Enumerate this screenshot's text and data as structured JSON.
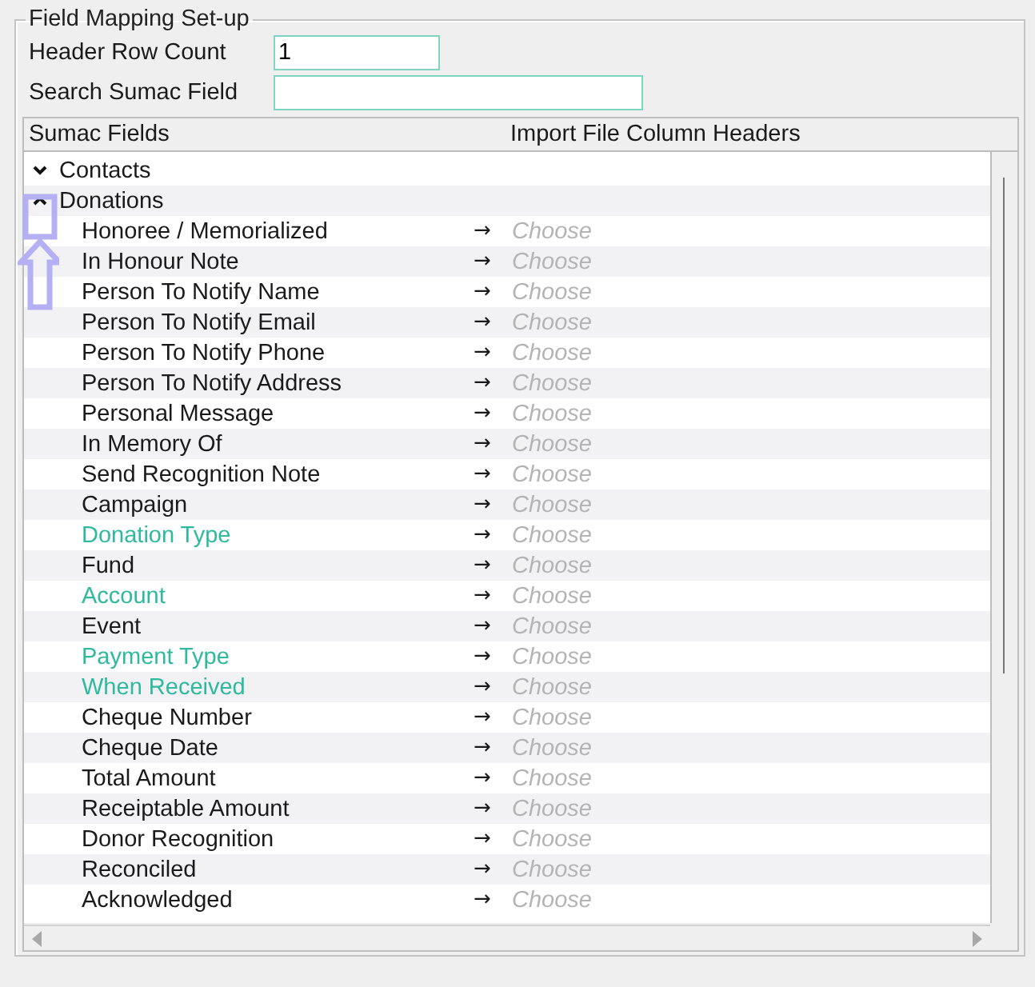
{
  "panel": {
    "title": "Field Mapping Set-up"
  },
  "header_row_count": {
    "label": "Header Row Count",
    "value": "1"
  },
  "search": {
    "label": "Search Sumac Field"
  },
  "table": {
    "columns": [
      "Sumac Fields",
      "Import File Column Headers"
    ],
    "groups": [
      {
        "label": "Contacts",
        "expanded": false
      },
      {
        "label": "Donations",
        "expanded": true,
        "children": [
          {
            "label": "Honoree / Memorialized",
            "required": false,
            "arrow": "→",
            "placeholder": "Choose"
          },
          {
            "label": "In Honour Note",
            "required": false,
            "arrow": "→",
            "placeholder": "Choose"
          },
          {
            "label": "Person To Notify Name",
            "required": false,
            "arrow": "→",
            "placeholder": "Choose"
          },
          {
            "label": "Person To Notify Email",
            "required": false,
            "arrow": "→",
            "placeholder": "Choose"
          },
          {
            "label": "Person To Notify Phone",
            "required": false,
            "arrow": "→",
            "placeholder": "Choose"
          },
          {
            "label": "Person To Notify Address",
            "required": false,
            "arrow": "→",
            "placeholder": "Choose"
          },
          {
            "label": "Personal Message",
            "required": false,
            "arrow": "→",
            "placeholder": "Choose"
          },
          {
            "label": "In Memory Of",
            "required": false,
            "arrow": "→",
            "placeholder": "Choose"
          },
          {
            "label": "Send Recognition Note",
            "required": false,
            "arrow": "→",
            "placeholder": "Choose"
          },
          {
            "label": "Campaign",
            "required": false,
            "arrow": "→",
            "placeholder": "Choose"
          },
          {
            "label": "Donation Type",
            "required": true,
            "arrow": "→",
            "placeholder": "Choose"
          },
          {
            "label": "Fund",
            "required": false,
            "arrow": "→",
            "placeholder": "Choose"
          },
          {
            "label": "Account",
            "required": true,
            "arrow": "→",
            "placeholder": "Choose"
          },
          {
            "label": "Event",
            "required": false,
            "arrow": "→",
            "placeholder": "Choose"
          },
          {
            "label": "Payment Type",
            "required": true,
            "arrow": "→",
            "placeholder": "Choose"
          },
          {
            "label": "When Received",
            "required": true,
            "arrow": "→",
            "placeholder": "Choose"
          },
          {
            "label": "Cheque Number",
            "required": false,
            "arrow": "→",
            "placeholder": "Choose"
          },
          {
            "label": "Cheque Date",
            "required": false,
            "arrow": "→",
            "placeholder": "Choose"
          },
          {
            "label": "Total Amount",
            "required": false,
            "arrow": "→",
            "placeholder": "Choose"
          },
          {
            "label": "Receiptable Amount",
            "required": false,
            "arrow": "→",
            "placeholder": "Choose"
          },
          {
            "label": "Donor Recognition",
            "required": false,
            "arrow": "→",
            "placeholder": "Choose"
          },
          {
            "label": "Reconciled",
            "required": false,
            "arrow": "→",
            "placeholder": "Choose"
          },
          {
            "label": "Acknowledged",
            "required": false,
            "arrow": "→",
            "placeholder": "Choose"
          }
        ]
      }
    ]
  }
}
